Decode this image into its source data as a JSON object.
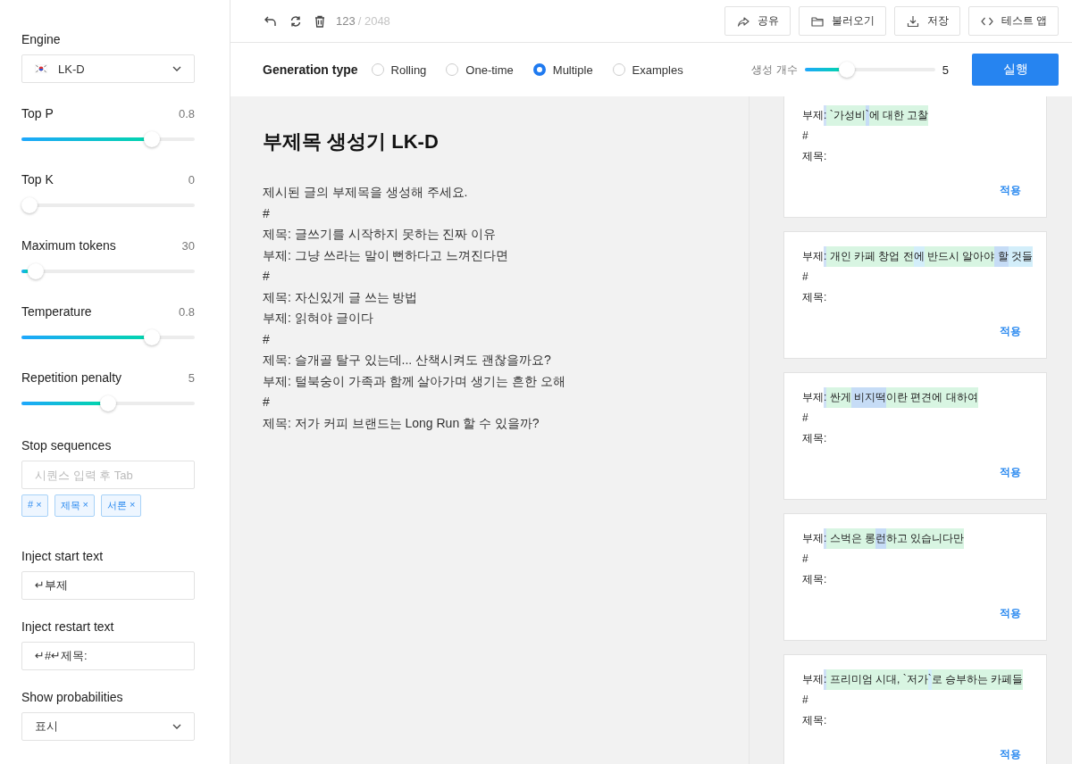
{
  "sidebar": {
    "engine": {
      "label": "Engine",
      "value": "LK-D"
    },
    "sliders": [
      {
        "label": "Top P",
        "reading": "0.8",
        "level": 0.78
      },
      {
        "label": "Top K",
        "reading": "0",
        "level": 0
      },
      {
        "label": "Maximum tokens",
        "reading": "30",
        "level": 0.04
      },
      {
        "label": "Temperature",
        "reading": "0.8",
        "level": 0.78
      },
      {
        "label": "Repetition penalty",
        "reading": "5",
        "level": 0.5
      }
    ],
    "stop_sequences": {
      "label": "Stop sequences",
      "placeholder": "시퀀스 입력 후 Tab",
      "tags": [
        {
          "text": "#",
          "remove": "×"
        },
        {
          "text": "제목",
          "remove": "×"
        },
        {
          "text": "서론",
          "remove": "×"
        }
      ]
    },
    "inject_start": {
      "label": "Inject start text",
      "value": "↵부제"
    },
    "inject_restart": {
      "label": "Inject restart text",
      "value": "↵#↵제목:"
    },
    "show_probabilities": {
      "label": "Show probabilities",
      "value": "표시"
    }
  },
  "toolbar": {
    "token_count": "123",
    "token_limit": "/ 2048",
    "buttons": [
      {
        "kind": "share",
        "label": "공유"
      },
      {
        "kind": "folder",
        "label": "불러오기"
      },
      {
        "kind": "download",
        "label": "저장"
      },
      {
        "kind": "code",
        "label": "테스트 앱"
      }
    ]
  },
  "generation": {
    "label": "Generation type",
    "options": [
      {
        "label": "Rolling",
        "selected": false
      },
      {
        "label": "One-time",
        "selected": false
      },
      {
        "label": "Multiple",
        "selected": true
      },
      {
        "label": "Examples",
        "selected": false
      }
    ],
    "count": {
      "label": "생성 개수",
      "level": 0.3,
      "reading": "5"
    },
    "run_button": "실행"
  },
  "prompt": {
    "title": "부제목 생성기 LK-D",
    "lines": [
      "제시된 글의 부제목을 생성해 주세요.",
      "#",
      "제목: 글쓰기를 시작하지 못하는 진짜 이유",
      "부제: 그냥 쓰라는 말이 뻔하다고 느껴진다면",
      "#",
      "제목: 자신있게 글 쓰는 방법",
      "부제: 읽혀야 글이다",
      "#",
      "제목: 슬개골 탈구 있는데... 산책시켜도 괜찮을까요?",
      "부제: 털북숭이 가족과 함께 살아가며 생기는 흔한 오해",
      "#",
      "제목: 저가 커피 브랜드는 Long Run 할 수 있을까?"
    ]
  },
  "results": [
    {
      "segments": [
        {
          "text": "부제"
        },
        {
          "text": ":",
          "color": "#cfe0f7"
        },
        {
          "text": " `가성비",
          "color": "#d8f5e2"
        },
        {
          "text": "`",
          "color": "#c6dcf6"
        },
        {
          "text": "에 대한 고찰",
          "color": "#d8f5e2"
        }
      ],
      "lines": [
        "#",
        "제목:"
      ],
      "apply": "적용"
    },
    {
      "segments": [
        {
          "text": "부제"
        },
        {
          "text": ":",
          "color": "#cfe0f7"
        },
        {
          "text": " 개인 카페 창업 전",
          "color": "#d8f5e2"
        },
        {
          "text": "에",
          "color": "#d3eefa"
        },
        {
          "text": " 반드시 알아야",
          "color": "#d8f5e2"
        },
        {
          "text": " 할",
          "color": "#c6dcf6"
        },
        {
          "text": " 것들",
          "color": "#d3eefa"
        }
      ],
      "lines": [
        "#",
        "제목:"
      ],
      "apply": "적용"
    },
    {
      "segments": [
        {
          "text": "부제"
        },
        {
          "text": ":",
          "color": "#cfe0f7"
        },
        {
          "text": " 싼게",
          "color": "#d8f5e2"
        },
        {
          "text": " 비지떡",
          "color": "#c6dcf6"
        },
        {
          "text": "이란 편견에 대하여",
          "color": "#d8f5e2"
        }
      ],
      "lines": [
        "#",
        "제목:"
      ],
      "apply": "적용"
    },
    {
      "segments": [
        {
          "text": "부제"
        },
        {
          "text": ":",
          "color": "#cfe0f7"
        },
        {
          "text": " 스벅은 롱",
          "color": "#d8f5e2"
        },
        {
          "text": "런",
          "color": "#c6dcf6"
        },
        {
          "text": "하고 있습니다만",
          "color": "#d8f5e2"
        }
      ],
      "lines": [
        "#",
        "제목:"
      ],
      "apply": "적용"
    },
    {
      "segments": [
        {
          "text": "부제"
        },
        {
          "text": ":",
          "color": "#cfe0f7"
        },
        {
          "text": " 프리미엄 시대, `저가",
          "color": "#d8f5e2"
        },
        {
          "text": "`",
          "color": "#d3eefa"
        },
        {
          "text": "로 승부하는 카페들",
          "color": "#d8f5e2"
        }
      ],
      "lines": [
        "#",
        "제목:"
      ],
      "apply": "적용"
    }
  ]
}
